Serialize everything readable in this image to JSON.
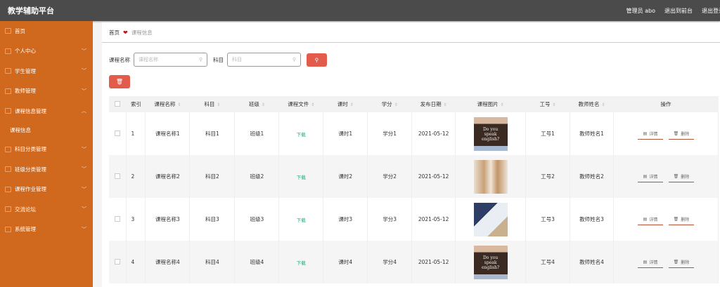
{
  "header": {
    "title": "教学辅助平台",
    "user": "管理员 abo",
    "front": "退出到前台",
    "logout": "退出登录"
  },
  "sidebar": {
    "items": [
      {
        "label": "首页"
      },
      {
        "label": "个人中心"
      },
      {
        "label": "学生管理"
      },
      {
        "label": "教师管理"
      },
      {
        "label": "课程信息管理"
      },
      {
        "label": "科目分类管理"
      },
      {
        "label": "班级分类管理"
      },
      {
        "label": "课程作业管理"
      },
      {
        "label": "交流论坛"
      },
      {
        "label": "系统管理"
      }
    ],
    "sub": "课程信息"
  },
  "breadcrumb": {
    "home": "首页",
    "current": "课程信息"
  },
  "search": {
    "name_label": "课程名称",
    "name_placeholder": "课程名称",
    "subject_label": "科目",
    "subject_placeholder": "科目"
  },
  "table": {
    "headers": [
      "索引",
      "课程名称",
      "科目",
      "班级",
      "课程文件",
      "课时",
      "学分",
      "发布日期",
      "课程图片",
      "工号",
      "教师姓名",
      "操作"
    ],
    "rows": [
      {
        "idx": "1",
        "name": "课程名称1",
        "subject": "科目1",
        "class": "班级1",
        "file": "下载",
        "hours": "课时1",
        "credit": "学分1",
        "date": "2021-05-12",
        "img": "p1",
        "no": "工号1",
        "teacher": "教师姓名1"
      },
      {
        "idx": "2",
        "name": "课程名称2",
        "subject": "科目2",
        "class": "班级2",
        "file": "下载",
        "hours": "课时2",
        "credit": "学分2",
        "date": "2021-05-12",
        "img": "p2",
        "no": "工号2",
        "teacher": "教师姓名2"
      },
      {
        "idx": "3",
        "name": "课程名称3",
        "subject": "科目3",
        "class": "班级3",
        "file": "下载",
        "hours": "课时3",
        "credit": "学分3",
        "date": "2021-05-12",
        "img": "p3",
        "no": "工号3",
        "teacher": "教师姓名3"
      },
      {
        "idx": "4",
        "name": "课程名称4",
        "subject": "科目4",
        "class": "班级4",
        "file": "下载",
        "hours": "课时4",
        "credit": "学分4",
        "date": "2021-05-12",
        "img": "p1",
        "no": "工号4",
        "teacher": "教师姓名4"
      }
    ],
    "detail": "详情",
    "delete": "删除",
    "pic_text": "Do you speak english?"
  }
}
